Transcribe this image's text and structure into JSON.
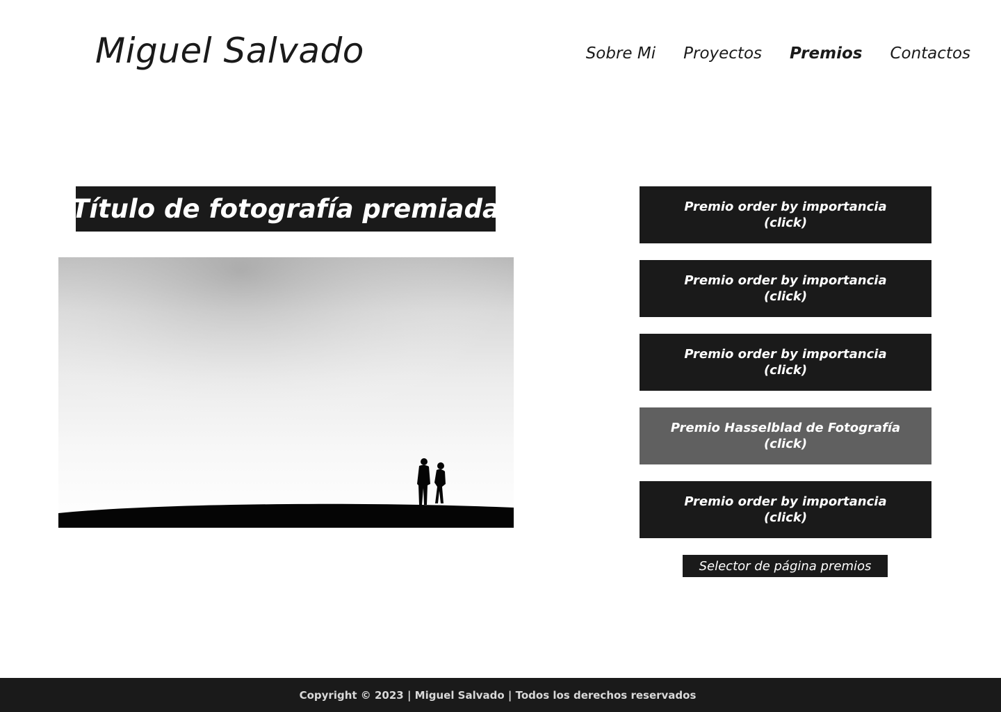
{
  "header": {
    "logo": "Miguel Salvado",
    "nav": [
      {
        "label": "Sobre Mi",
        "active": false
      },
      {
        "label": "Proyectos",
        "active": false
      },
      {
        "label": "Premios",
        "active": true
      },
      {
        "label": "Contactos",
        "active": false
      }
    ]
  },
  "main": {
    "photo_title": "Título de fotografía premiada",
    "awards": [
      {
        "line1": "Premio order by importancia",
        "line2": "(click)"
      },
      {
        "line1": "Premio order by importancia",
        "line2": "(click)"
      },
      {
        "line1": "Premio order by importancia",
        "line2": "(click)"
      },
      {
        "line1": "Premio Hasselblad de Fotografía",
        "line2": "(click)"
      },
      {
        "line1": "Premio order by importancia",
        "line2": "(click)"
      }
    ],
    "page_selector": "Selector de página premios"
  },
  "footer": {
    "copyright": "Copyright © 2023 | Miguel Salvado | Todos los derechos reservados"
  },
  "colors": {
    "dark": "#1a1a1a",
    "highlight": "#606060",
    "background": "#ffffff"
  }
}
